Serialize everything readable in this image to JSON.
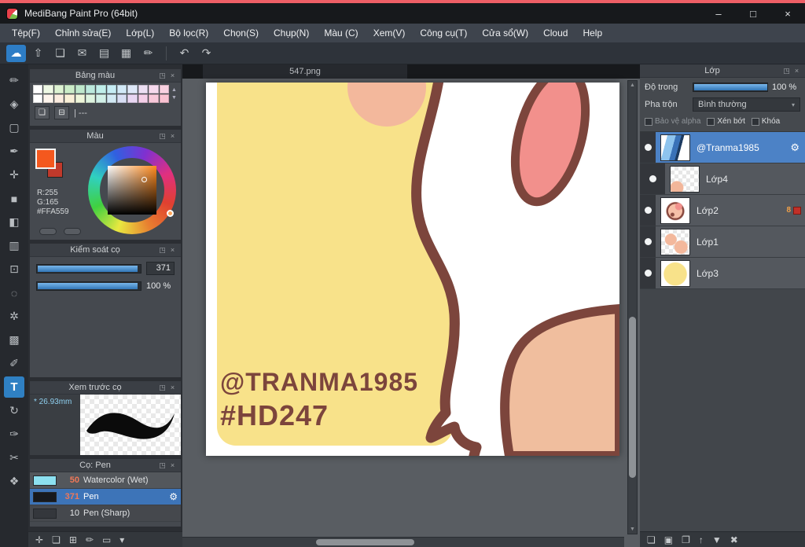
{
  "window": {
    "title": "MediBang Paint Pro (64bit)",
    "minimize_glyph": "–",
    "maximize_glyph": "□",
    "close_glyph": "×"
  },
  "menu": {
    "items": [
      "Tệp(F)",
      "Chỉnh sửa(E)",
      "Lớp(L)",
      "Bộ lọc(R)",
      "Chọn(S)",
      "Chụp(N)",
      "Màu (C)",
      "Xem(V)",
      "Công cụ(T)",
      "Cửa sổ(W)",
      "Cloud",
      "Help"
    ]
  },
  "panel_icons": {
    "float": "◳",
    "close": "×"
  },
  "scroll": {
    "up": "▲",
    "down": "▼"
  },
  "toolbar": {
    "buttons": [
      {
        "name": "cloud-save",
        "glyph": "☁"
      },
      {
        "name": "export",
        "glyph": "⇧"
      },
      {
        "name": "comment",
        "glyph": "❏"
      },
      {
        "name": "chat",
        "glyph": "✉"
      },
      {
        "name": "pages",
        "glyph": "▤"
      },
      {
        "name": "grid-view",
        "glyph": "▦"
      },
      {
        "name": "edit-doc",
        "glyph": "✏"
      },
      {
        "name": "undo",
        "glyph": "↶"
      },
      {
        "name": "redo",
        "glyph": "↷"
      }
    ]
  },
  "tools": {
    "items": [
      {
        "name": "brush-tool",
        "glyph": "✏"
      },
      {
        "name": "eraser-tool",
        "glyph": "◈"
      },
      {
        "name": "shape-brush-tool",
        "glyph": "▢"
      },
      {
        "name": "pen-tool",
        "glyph": "✒"
      },
      {
        "name": "move-tool",
        "glyph": "✛"
      },
      {
        "name": "fill-rect-tool",
        "glyph": "■"
      },
      {
        "name": "bucket-tool",
        "glyph": "◧"
      },
      {
        "name": "gradient-tool",
        "glyph": "▥"
      },
      {
        "name": "select-tool",
        "glyph": "⊡"
      },
      {
        "name": "lasso-tool",
        "glyph": "◌"
      },
      {
        "name": "magic-wand-tool",
        "glyph": "✲"
      },
      {
        "name": "pattern-tool",
        "glyph": "▩"
      },
      {
        "name": "select-pen-tool",
        "glyph": "✐"
      },
      {
        "name": "text-tool",
        "glyph": "T"
      },
      {
        "name": "rotate-tool",
        "glyph": "↻"
      },
      {
        "name": "control-pen-tool",
        "glyph": "✑"
      },
      {
        "name": "divide-tool",
        "glyph": "✂"
      },
      {
        "name": "hand-tool",
        "glyph": "❖"
      }
    ]
  },
  "palette_panel": {
    "title": "Bảng màu",
    "note": "| ---",
    "new_glyph": "❏",
    "delete_glyph": "⊟",
    "row1": [
      "#ffffff",
      "#eef8e4",
      "#ddf2d2",
      "#cbecc8",
      "#bfe8cc",
      "#bce9dd",
      "#c0eeea",
      "#c6ecf4",
      "#d2e9f7",
      "#dee8f8",
      "#ecdff3",
      "#f6d9ed",
      "#f9d1e1"
    ],
    "row2": [
      "#ffffff",
      "#fdf4ec",
      "#fbece0",
      "#f9f0d8",
      "#eef6da",
      "#def4e0",
      "#d2f0e8",
      "#d2e9f4",
      "#d8def4",
      "#e8d6f2",
      "#f4cfe8",
      "#f8c8da",
      "#fac2d2"
    ]
  },
  "color_panel": {
    "title": "Màu",
    "fg": "#F4581E",
    "bg": "#C0392B",
    "r_label": "R:255",
    "g_label": "G:165",
    "hex_label": "#FFA559",
    "current": "#FFA559"
  },
  "brush_control_panel": {
    "title": "Kiểm soát cọ",
    "size_value": "371",
    "opacity_value": "100 %"
  },
  "brush_preview_panel": {
    "title": "Xem trước cọ",
    "size_text": "* 26.93mm"
  },
  "brush_list_panel": {
    "title": "Cọ: Pen",
    "gear_glyph": "⚙",
    "brushes": [
      {
        "size": "50",
        "name": "Watercolor (Wet)",
        "swatch": "#8ce0f0"
      },
      {
        "size": "371",
        "name": "Pen",
        "swatch": "#17191d"
      },
      {
        "size": "10",
        "name": "Pen (Sharp)",
        "swatch": "#34373c"
      }
    ]
  },
  "left_bottom_bar": {
    "icons": [
      {
        "name": "add-brush",
        "glyph": "✛"
      },
      {
        "name": "new-brush",
        "glyph": "❏"
      },
      {
        "name": "brush-grid",
        "glyph": "⊞"
      },
      {
        "name": "edit-brush",
        "glyph": "✏"
      },
      {
        "name": "brush-folder",
        "glyph": "▭"
      },
      {
        "name": "brush-menu",
        "glyph": "▾"
      }
    ]
  },
  "canvas": {
    "tab": "547.png"
  },
  "artwork": {
    "yellow": "#F8E28A",
    "outline": "#7C453C",
    "peach": "#F3B89C",
    "peach2": "#F0BE9E",
    "pink": "#F2908C",
    "white": "#FFFFFF",
    "text1": "@TRANMA1985",
    "text2": "#HD247"
  },
  "layers_panel": {
    "title": "Lớp",
    "opacity_label": "Độ trong",
    "opacity_value": "100 %",
    "blend_label": "Pha trộn",
    "blend_value": "Bình thường",
    "blend_arrow": "▾",
    "check_alpha": "Bảo vệ alpha",
    "check_clip": "Xén bớt",
    "check_lock": "Khóa",
    "gear_glyph": "⚙",
    "layers": [
      {
        "name": "@Tranma1985"
      },
      {
        "name": "Lớp4"
      },
      {
        "name": "Lớp2",
        "badge": "8"
      },
      {
        "name": "Lớp1"
      },
      {
        "name": "Lớp3"
      }
    ],
    "bottom_icons": [
      {
        "name": "add-layer",
        "glyph": "❏"
      },
      {
        "name": "add-folder",
        "glyph": "▣"
      },
      {
        "name": "duplicate-layer",
        "glyph": "❐"
      },
      {
        "name": "move-layer-up",
        "glyph": "↑"
      },
      {
        "name": "merge-layer",
        "glyph": "▼"
      },
      {
        "name": "delete-layer",
        "glyph": "✖"
      }
    ]
  }
}
